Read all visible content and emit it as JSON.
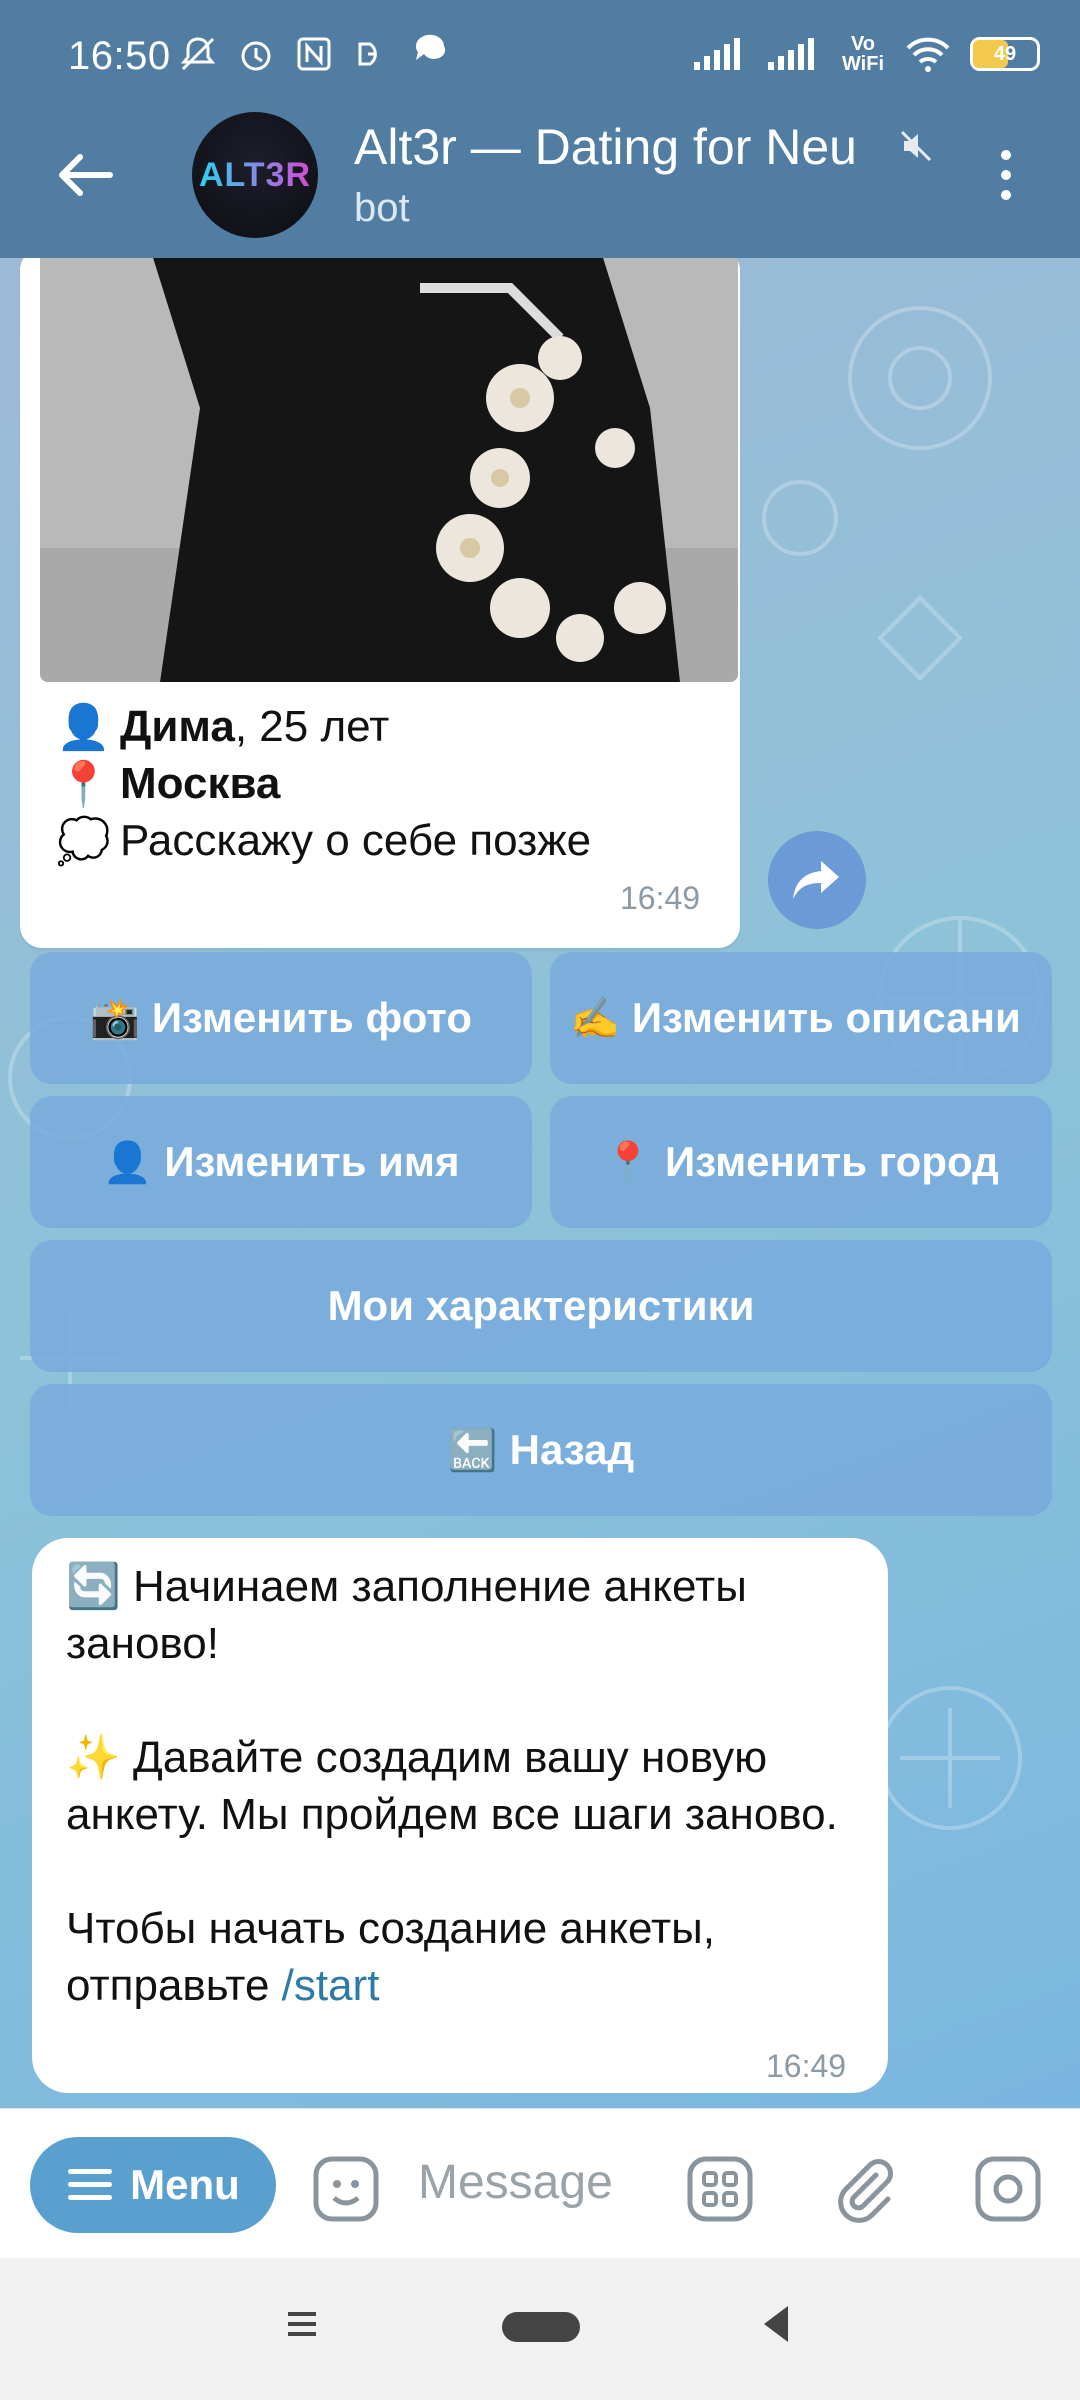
{
  "status_bar": {
    "time": "16:50",
    "battery": "49",
    "network_label": "Vo WiFi"
  },
  "header": {
    "title": "Alt3r — Dating for Neu",
    "subtitle": "bot",
    "avatar_text": "ALT3R"
  },
  "profile_message": {
    "name": "Дима",
    "age": ", 25 лет",
    "city": "Москва",
    "about": "Расскажу о себе позже",
    "time": "16:49",
    "icons": [
      "bust-in-silhouette-icon",
      "round-pushpin-icon",
      "thought-balloon-icon"
    ]
  },
  "keyboard": {
    "change_photo": "Изменить фото",
    "change_description": "Изменить описани",
    "change_name": "Изменить имя",
    "change_city": "Изменить город",
    "my_traits": "Мои характеристики",
    "back": "Назад"
  },
  "bot_message": {
    "line1": "Начинаем заполнение анкеты заново!",
    "line2": "Давайте создадим вашу новую анкету. Мы пройдем все шаги заново.",
    "line3_prefix": "Чтобы начать создание анкеты, отправьте ",
    "line3_link": "/start",
    "time": "16:49"
  },
  "input_bar": {
    "menu_label": "Menu",
    "placeholder": "Message"
  },
  "colors": {
    "header_bg": "#517da2",
    "keyboard_btn": "#78aadc",
    "menu_pill": "#5aa0cf",
    "link": "#2d7aa6"
  }
}
